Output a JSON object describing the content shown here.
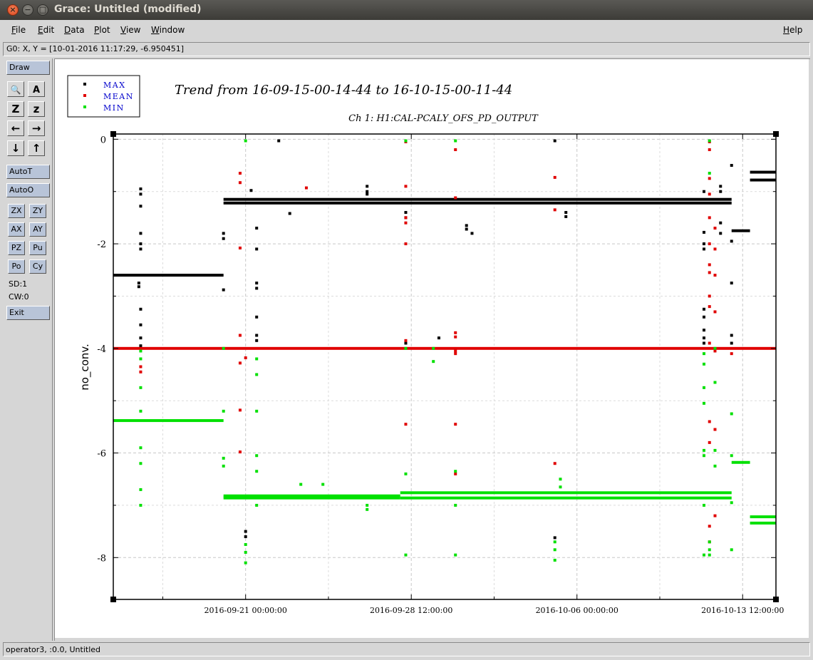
{
  "window": {
    "title": "Grace: Untitled (modified)",
    "close_glyph": "×",
    "min_glyph": "−",
    "max_glyph": "□"
  },
  "menu": {
    "items": [
      "File",
      "Edit",
      "Data",
      "Plot",
      "View",
      "Window"
    ],
    "help": "Help"
  },
  "locator": {
    "text": "G0: X, Y = [10-01-2016 11:17:29, -6.950451]"
  },
  "toolbar": {
    "draw": "Draw",
    "autot": "AutoT",
    "autoo": "AutoO",
    "zx": "ZX",
    "zy": "ZY",
    "ax": "AX",
    "ay": "AY",
    "pz": "PZ",
    "pu": "Pu",
    "po": "Po",
    "cy": "Cy",
    "sd": "SD:1",
    "cw": "CW:0",
    "exit": "Exit",
    "icons": [
      "zoom-icon",
      "autoscale-text-icon",
      "zoom-in-icon",
      "zoom-out-icon",
      "scroll-left-icon",
      "scroll-right-icon",
      "scroll-down-icon",
      "scroll-up-icon"
    ],
    "icon_glyphs": {
      "zoom": "🔍",
      "text": "A",
      "z_big": "Z",
      "z_small": "z",
      "left": "←",
      "right": "→",
      "down": "↓",
      "up": "↑"
    }
  },
  "status": {
    "text": "operator3, :0.0, Untitled"
  },
  "chart_data": {
    "type": "scatter",
    "title": "Trend from 16-09-15-00-14-44 to 16-10-15-00-11-44",
    "subtitle": "Ch 1: H1:CAL-PCALY_OFS_PD_OUTPUT",
    "xlabel": "",
    "ylabel": "no_conv.",
    "x_ticks": [
      "2016-09-21 00:00:00",
      "2016-09-28 12:00:00",
      "2016-10-06 00:00:00",
      "2016-10-13 12:00:00"
    ],
    "y_ticks": [
      "0",
      "-2",
      "-4",
      "-6",
      "-8"
    ],
    "ylim": [
      -8.8,
      0.1
    ],
    "xlim": [
      "2016-09-15 00:14:44",
      "2016-10-15 00:11:44"
    ],
    "grid": true,
    "legend_position": "top-left",
    "colors": {
      "MAX": "#000000",
      "MEAN": "#e00000",
      "MIN": "#00e000",
      "legend_text": "#0000cc"
    },
    "series": [
      {
        "name": "MAX",
        "levels": [
          {
            "x_start": "2016-09-15",
            "x_end": "2016-09-20",
            "y": -2.6
          },
          {
            "x_start": "2016-09-20",
            "x_end": "2016-10-13",
            "y": -1.15
          },
          {
            "x_start": "2016-09-20",
            "x_end": "2016-10-13",
            "y": -1.22
          },
          {
            "x_start": "2016-10-13",
            "x_end": "2016-10-13 20:00",
            "y": -1.75
          },
          {
            "x_start": "2016-10-13 20:00",
            "x_end": "2016-10-15",
            "y": -0.63
          },
          {
            "x_start": "2016-10-13 20:00",
            "x_end": "2016-10-15",
            "y": -0.78
          }
        ],
        "points": [
          [
            "2016-09-16 06:00",
            -0.95
          ],
          [
            "2016-09-16 06:00",
            -1.05
          ],
          [
            "2016-09-16 06:00",
            -1.28
          ],
          [
            "2016-09-16 06:00",
            -1.8
          ],
          [
            "2016-09-16 06:00",
            -2.0
          ],
          [
            "2016-09-16 06:00",
            -2.1
          ],
          [
            "2016-09-16 04:00",
            -2.75
          ],
          [
            "2016-09-16 04:00",
            -2.82
          ],
          [
            "2016-09-16 06:00",
            -3.25
          ],
          [
            "2016-09-16 06:00",
            -3.55
          ],
          [
            "2016-09-16 06:00",
            -3.8
          ],
          [
            "2016-09-16 06:00",
            -3.95
          ],
          [
            "2016-09-20 00:00",
            -1.8
          ],
          [
            "2016-09-20 00:00",
            -1.9
          ],
          [
            "2016-09-20 00:00",
            -2.88
          ],
          [
            "2016-09-21 06:00",
            -0.98
          ],
          [
            "2016-09-21 12:00",
            -1.7
          ],
          [
            "2016-09-21 12:00",
            -2.1
          ],
          [
            "2016-09-21 12:00",
            -2.75
          ],
          [
            "2016-09-21 12:00",
            -2.85
          ],
          [
            "2016-09-21 12:00",
            -3.4
          ],
          [
            "2016-09-21 12:00",
            -3.75
          ],
          [
            "2016-09-21 12:00",
            -3.85
          ],
          [
            "2016-09-21 00:00",
            -7.5
          ],
          [
            "2016-09-21 00:00",
            -7.6
          ],
          [
            "2016-09-22 12:00",
            -0.03
          ],
          [
            "2016-09-23 00:00",
            -1.42
          ],
          [
            "2016-09-26 12:00",
            -0.9
          ],
          [
            "2016-09-26 12:00",
            -1.0
          ],
          [
            "2016-09-26 12:00",
            -1.05
          ],
          [
            "2016-09-28 06:00",
            -1.4
          ],
          [
            "2016-09-28 06:00",
            -1.5
          ],
          [
            "2016-09-28 06:00",
            -3.9
          ],
          [
            "2016-09-29 18:00",
            -3.8
          ],
          [
            "2016-10-01 00:00",
            -1.65
          ],
          [
            "2016-10-01 00:00",
            -1.72
          ],
          [
            "2016-10-01 06:00",
            -1.8
          ],
          [
            "2016-10-05 00:00",
            -0.03
          ],
          [
            "2016-10-05 12:00",
            -1.4
          ],
          [
            "2016-10-05 12:00",
            -1.48
          ],
          [
            "2016-10-05 00:00",
            -7.62
          ],
          [
            "2016-10-11 18:00",
            -1.0
          ],
          [
            "2016-10-11 18:00",
            -1.78
          ],
          [
            "2016-10-11 18:00",
            -2.0
          ],
          [
            "2016-10-11 18:00",
            -2.1
          ],
          [
            "2016-10-11 18:00",
            -3.25
          ],
          [
            "2016-10-11 18:00",
            -3.4
          ],
          [
            "2016-10-11 18:00",
            -3.65
          ],
          [
            "2016-10-11 18:00",
            -3.8
          ],
          [
            "2016-10-11 18:00",
            -3.9
          ],
          [
            "2016-10-12 12:00",
            -0.9
          ],
          [
            "2016-10-12 12:00",
            -1.0
          ],
          [
            "2016-10-12 12:00",
            -1.6
          ],
          [
            "2016-10-12 12:00",
            -1.8
          ],
          [
            "2016-10-13 00:00",
            -0.5
          ],
          [
            "2016-10-13 00:00",
            -1.95
          ],
          [
            "2016-10-13 00:00",
            -2.75
          ],
          [
            "2016-10-13 00:00",
            -3.75
          ],
          [
            "2016-10-13 00:00",
            -3.9
          ]
        ]
      },
      {
        "name": "MEAN",
        "levels": [
          {
            "x_start": "2016-09-15",
            "x_end": "2016-10-15",
            "y": -4.0
          }
        ],
        "points": [
          [
            "2016-09-16 06:00",
            -4.35
          ],
          [
            "2016-09-16 06:00",
            -4.45
          ],
          [
            "2016-09-20 18:00",
            -0.65
          ],
          [
            "2016-09-20 18:00",
            -0.83
          ],
          [
            "2016-09-20 18:00",
            -2.08
          ],
          [
            "2016-09-20 18:00",
            -3.75
          ],
          [
            "2016-09-20 18:00",
            -4.28
          ],
          [
            "2016-09-20 18:00",
            -5.18
          ],
          [
            "2016-09-20 18:00",
            -5.98
          ],
          [
            "2016-09-21 00:00",
            -4.18
          ],
          [
            "2016-09-23 18:00",
            -0.93
          ],
          [
            "2016-09-28 06:00",
            -0.05
          ],
          [
            "2016-09-28 06:00",
            -0.9
          ],
          [
            "2016-09-28 06:00",
            -1.5
          ],
          [
            "2016-09-28 06:00",
            -1.6
          ],
          [
            "2016-09-28 06:00",
            -2.0
          ],
          [
            "2016-09-28 06:00",
            -3.85
          ],
          [
            "2016-09-28 06:00",
            -5.45
          ],
          [
            "2016-09-30 12:00",
            -0.2
          ],
          [
            "2016-09-30 12:00",
            -1.12
          ],
          [
            "2016-09-30 12:00",
            -3.7
          ],
          [
            "2016-09-30 12:00",
            -3.78
          ],
          [
            "2016-09-30 12:00",
            -4.05
          ],
          [
            "2016-09-30 12:00",
            -4.1
          ],
          [
            "2016-09-30 12:00",
            -5.45
          ],
          [
            "2016-09-30 12:00",
            -6.4
          ],
          [
            "2016-10-05 00:00",
            -0.73
          ],
          [
            "2016-10-05 00:00",
            -1.35
          ],
          [
            "2016-10-05 00:00",
            -6.2
          ],
          [
            "2016-10-12 00:00",
            -0.05
          ],
          [
            "2016-10-12 00:00",
            -0.2
          ],
          [
            "2016-10-12 00:00",
            -0.75
          ],
          [
            "2016-10-12 00:00",
            -1.05
          ],
          [
            "2016-10-12 00:00",
            -1.5
          ],
          [
            "2016-10-12 00:00",
            -2.0
          ],
          [
            "2016-10-12 00:00",
            -2.4
          ],
          [
            "2016-10-12 00:00",
            -2.55
          ],
          [
            "2016-10-12 00:00",
            -3.0
          ],
          [
            "2016-10-12 00:00",
            -3.2
          ],
          [
            "2016-10-12 00:00",
            -3.9
          ],
          [
            "2016-10-12 00:00",
            -5.4
          ],
          [
            "2016-10-12 00:00",
            -5.8
          ],
          [
            "2016-10-12 00:00",
            -7.4
          ],
          [
            "2016-10-12 00:00",
            -7.7
          ],
          [
            "2016-10-12 06:00",
            -1.7
          ],
          [
            "2016-10-12 06:00",
            -2.1
          ],
          [
            "2016-10-12 06:00",
            -2.6
          ],
          [
            "2016-10-12 06:00",
            -3.3
          ],
          [
            "2016-10-12 06:00",
            -4.05
          ],
          [
            "2016-10-12 06:00",
            -5.55
          ],
          [
            "2016-10-12 06:00",
            -7.2
          ],
          [
            "2016-10-13 00:00",
            -4.1
          ]
        ]
      },
      {
        "name": "MIN",
        "levels": [
          {
            "x_start": "2016-09-15",
            "x_end": "2016-09-20",
            "y": -5.38
          },
          {
            "x_start": "2016-09-20",
            "x_end": "2016-09-28",
            "y": -6.82
          },
          {
            "x_start": "2016-09-20",
            "x_end": "2016-09-28",
            "y": -6.86
          },
          {
            "x_start": "2016-09-28",
            "x_end": "2016-10-13",
            "y": -6.76
          },
          {
            "x_start": "2016-09-28",
            "x_end": "2016-10-13",
            "y": -6.86
          },
          {
            "x_start": "2016-10-13",
            "x_end": "2016-10-13 20:00",
            "y": -6.18
          },
          {
            "x_start": "2016-10-13 20:00",
            "x_end": "2016-10-15",
            "y": -7.22
          },
          {
            "x_start": "2016-10-13 20:00",
            "x_end": "2016-10-15",
            "y": -7.34
          }
        ],
        "points": [
          [
            "2016-09-16 06:00",
            -4.05
          ],
          [
            "2016-09-16 06:00",
            -4.2
          ],
          [
            "2016-09-16 06:00",
            -4.75
          ],
          [
            "2016-09-16 06:00",
            -5.2
          ],
          [
            "2016-09-16 06:00",
            -5.9
          ],
          [
            "2016-09-16 06:00",
            -6.2
          ],
          [
            "2016-09-16 06:00",
            -6.7
          ],
          [
            "2016-09-16 06:00",
            -7.0
          ],
          [
            "2016-09-20 00:00",
            -4.0
          ],
          [
            "2016-09-20 00:00",
            -5.2
          ],
          [
            "2016-09-20 00:00",
            -6.1
          ],
          [
            "2016-09-20 00:00",
            -6.25
          ],
          [
            "2016-09-21 00:00",
            -0.03
          ],
          [
            "2016-09-21 00:00",
            -7.75
          ],
          [
            "2016-09-21 00:00",
            -7.9
          ],
          [
            "2016-09-21 00:00",
            -8.1
          ],
          [
            "2016-09-21 12:00",
            -4.2
          ],
          [
            "2016-09-21 12:00",
            -4.5
          ],
          [
            "2016-09-21 12:00",
            -5.2
          ],
          [
            "2016-09-21 12:00",
            -6.05
          ],
          [
            "2016-09-21 12:00",
            -6.35
          ],
          [
            "2016-09-21 12:00",
            -7.0
          ],
          [
            "2016-09-23 12:00",
            -6.6
          ],
          [
            "2016-09-24 12:00",
            -6.6
          ],
          [
            "2016-09-26 12:00",
            -7.0
          ],
          [
            "2016-09-26 12:00",
            -7.08
          ],
          [
            "2016-09-28 06:00",
            -0.03
          ],
          [
            "2016-09-28 06:00",
            -4.0
          ],
          [
            "2016-09-28 06:00",
            -6.4
          ],
          [
            "2016-09-28 06:00",
            -7.95
          ],
          [
            "2016-09-29 12:00",
            -4.0
          ],
          [
            "2016-09-29 12:00",
            -4.25
          ],
          [
            "2016-09-30 12:00",
            -0.03
          ],
          [
            "2016-09-30 12:00",
            -6.35
          ],
          [
            "2016-09-30 12:00",
            -7.0
          ],
          [
            "2016-09-30 12:00",
            -7.95
          ],
          [
            "2016-10-05 00:00",
            -7.7
          ],
          [
            "2016-10-05 00:00",
            -7.85
          ],
          [
            "2016-10-05 00:00",
            -8.05
          ],
          [
            "2016-10-05 06:00",
            -6.5
          ],
          [
            "2016-10-05 06:00",
            -6.65
          ],
          [
            "2016-10-11 18:00",
            -4.1
          ],
          [
            "2016-10-11 18:00",
            -4.3
          ],
          [
            "2016-10-11 18:00",
            -4.75
          ],
          [
            "2016-10-11 18:00",
            -5.05
          ],
          [
            "2016-10-11 18:00",
            -5.95
          ],
          [
            "2016-10-11 18:00",
            -6.05
          ],
          [
            "2016-10-11 18:00",
            -7.0
          ],
          [
            "2016-10-11 18:00",
            -7.95
          ],
          [
            "2016-10-12 00:00",
            -0.03
          ],
          [
            "2016-10-12 00:00",
            -0.65
          ],
          [
            "2016-10-12 00:00",
            -7.7
          ],
          [
            "2016-10-12 00:00",
            -7.85
          ],
          [
            "2016-10-12 00:00",
            -7.95
          ],
          [
            "2016-10-12 06:00",
            -4.0
          ],
          [
            "2016-10-12 06:00",
            -4.65
          ],
          [
            "2016-10-12 06:00",
            -5.95
          ],
          [
            "2016-10-12 06:00",
            -6.25
          ],
          [
            "2016-10-13 00:00",
            -5.25
          ],
          [
            "2016-10-13 00:00",
            -6.05
          ],
          [
            "2016-10-13 00:00",
            -6.95
          ],
          [
            "2016-10-13 00:00",
            -7.85
          ]
        ]
      }
    ]
  }
}
